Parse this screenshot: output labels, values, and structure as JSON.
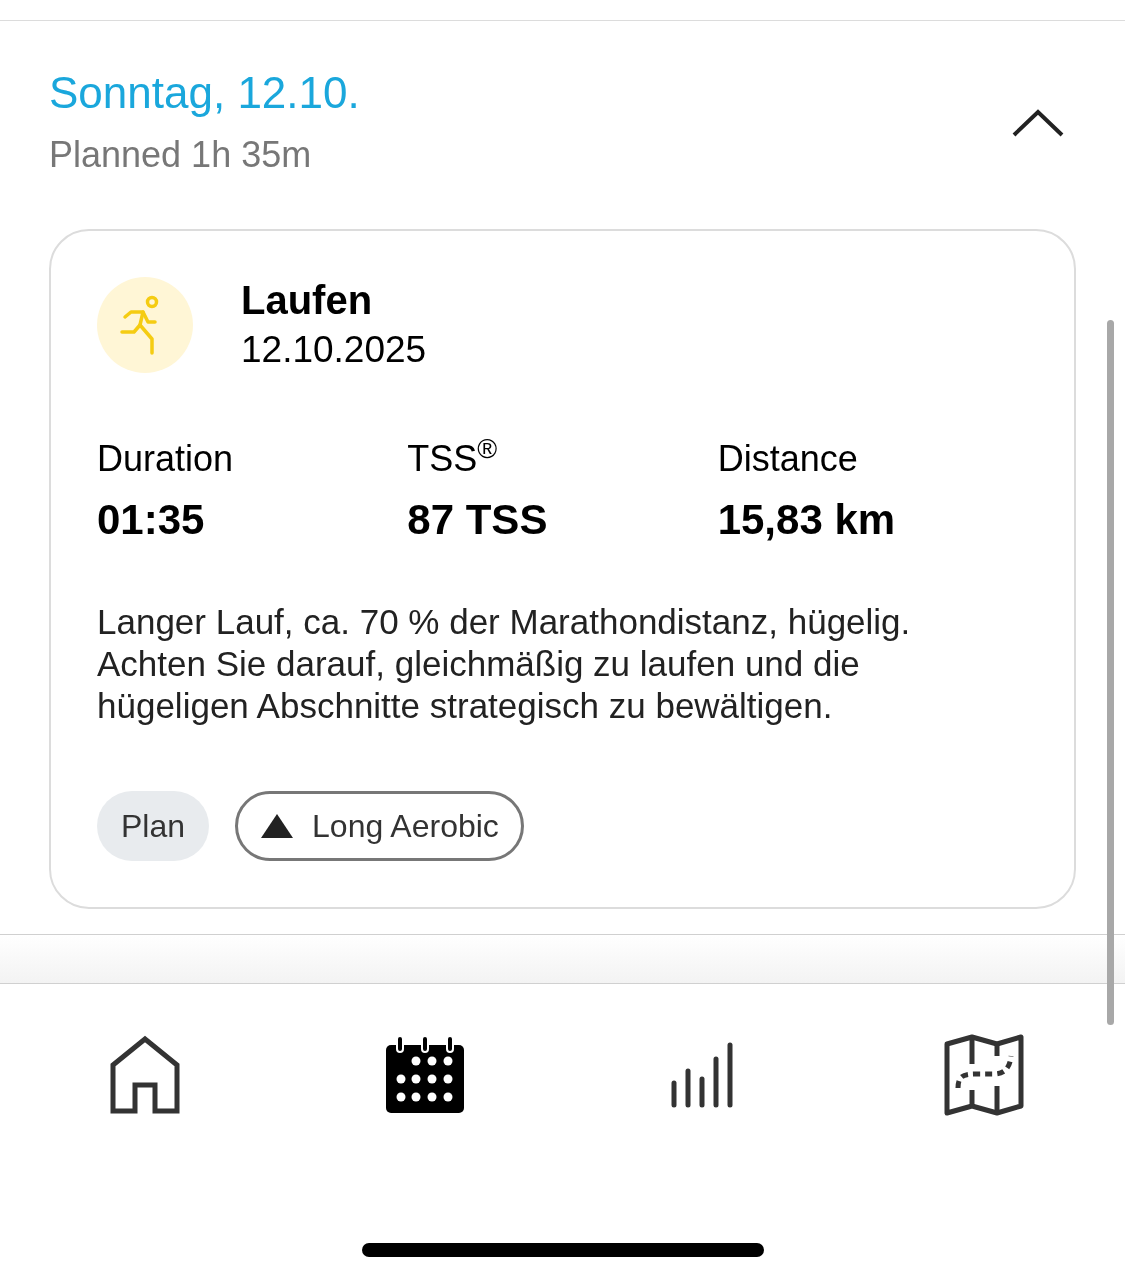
{
  "day": {
    "title": "Sonntag, 12.10.",
    "subtitle": "Planned 1h 35m",
    "expanded": true
  },
  "workout": {
    "name": "Laufen",
    "date": "12.10.2025",
    "stats": [
      {
        "label": "Duration",
        "value": "01:35"
      },
      {
        "label": "TSS$^{®}$",
        "value": "87 TSS"
      },
      {
        "label": "Distance",
        "value": "15,83 km"
      }
    ],
    "description": "Langer Lauf, ca. 70 % der Marathondistanz, hügelig. Achten Sie darauf, gleichmäßig zu laufen und die hügeligen Abschnitte strategisch zu bewältigen.",
    "tags": [
      {
        "kind": "filled",
        "label": "Plan"
      },
      {
        "kind": "outlined",
        "label": "Long Aerobic"
      }
    ]
  },
  "nav": [
    {
      "kind": "home",
      "selected": false
    },
    {
      "kind": "calendar",
      "selected": true
    },
    {
      "kind": "stats",
      "selected": false
    },
    {
      "kind": "map",
      "selected": false
    }
  ]
}
